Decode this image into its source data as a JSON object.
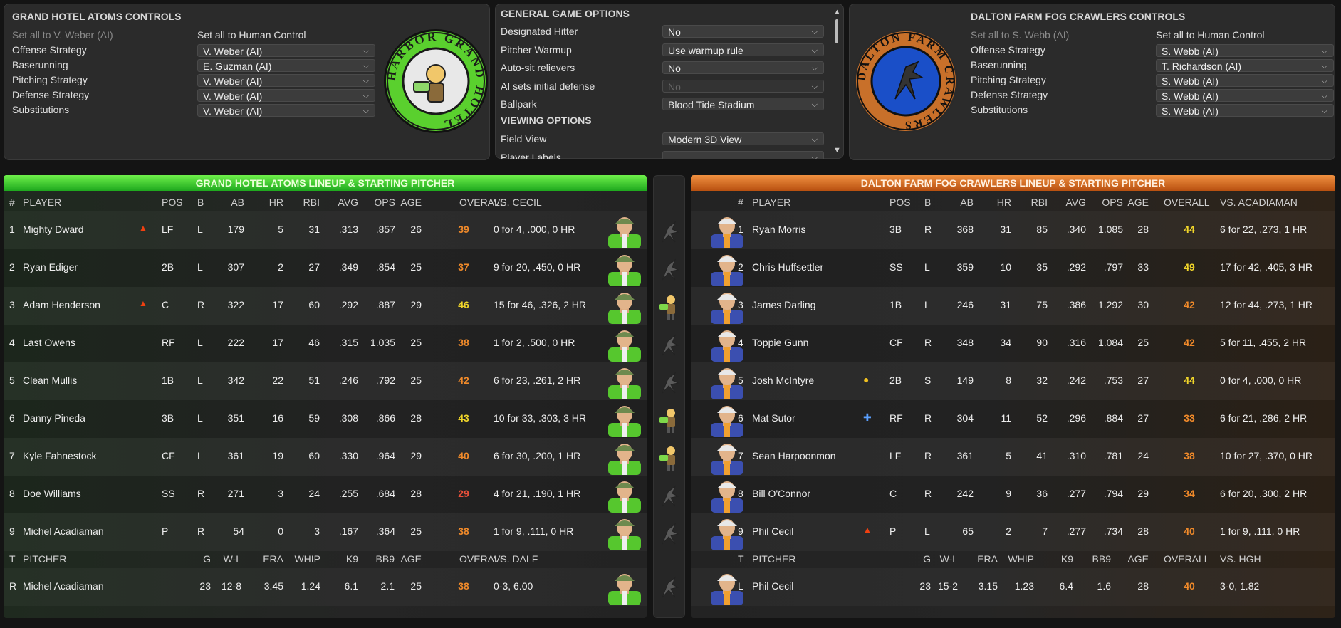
{
  "home_controls": {
    "title": "GRAND HOTEL ATOMS CONTROLS",
    "set_ai": "Set all to V. Weber (AI)",
    "set_human": "Set all to Human Control",
    "rows": [
      {
        "label": "Offense Strategy",
        "value": "V. Weber (AI)"
      },
      {
        "label": "Baserunning",
        "value": "E. Guzman (AI)"
      },
      {
        "label": "Pitching Strategy",
        "value": "V. Weber (AI)"
      },
      {
        "label": "Defense Strategy",
        "value": "V. Weber (AI)"
      },
      {
        "label": "Substitutions",
        "value": "V. Weber (AI)"
      }
    ],
    "logo_text": "HARBOR GRAND HOTEL"
  },
  "options": {
    "title": "GENERAL GAME OPTIONS",
    "rows": [
      {
        "label": "Designated Hitter",
        "value": "No"
      },
      {
        "label": "Pitcher Warmup",
        "value": "Use warmup rule"
      },
      {
        "label": "Auto-sit relievers",
        "value": "No"
      },
      {
        "label": "AI sets initial defense",
        "value": "No"
      },
      {
        "label": "Ballpark",
        "value": "Blood Tide Stadium"
      }
    ],
    "viewing_title": "VIEWING OPTIONS",
    "view_rows": [
      {
        "label": "Field View",
        "value": "Modern 3D View"
      },
      {
        "label": "Player Labels",
        "value": ""
      }
    ]
  },
  "away_controls": {
    "title": "DALTON FARM FOG CRAWLERS CONTROLS",
    "set_ai": "Set all to S. Webb (AI)",
    "set_human": "Set all to Human Control",
    "rows": [
      {
        "label": "Offense Strategy",
        "value": "S. Webb (AI)"
      },
      {
        "label": "Baserunning",
        "value": "T. Richardson (AI)"
      },
      {
        "label": "Pitching Strategy",
        "value": "S. Webb (AI)"
      },
      {
        "label": "Defense Strategy",
        "value": "S. Webb (AI)"
      },
      {
        "label": "Substitutions",
        "value": "S. Webb (AI)"
      }
    ],
    "logo_text": "DALTON FARM CRAWLERS"
  },
  "colors": {
    "green": "#2aa82a",
    "orange": "#d0651a",
    "ovr_orange": "#f08a2a",
    "ovr_yellow": "#f0d52a",
    "ovr_red": "#e8503a"
  },
  "left": {
    "bar_title": "GRAND HOTEL ATOMS LINEUP & STARTING PITCHER",
    "headers": {
      "num": "#",
      "player": "PLAYER",
      "pos": "POS",
      "b": "B",
      "ab": "AB",
      "hr": "HR",
      "rbi": "RBI",
      "avg": "AVG",
      "ops": "OPS",
      "age": "AGE",
      "ovr": "OVERALL",
      "vs": "VS. CECIL"
    },
    "players": [
      {
        "n": "1",
        "name": "Mighty Dward",
        "icon": "fire",
        "pos": "LF",
        "b": "L",
        "ab": "179",
        "hr": "5",
        "rbi": "31",
        "avg": ".313",
        "ops": ".857",
        "age": "26",
        "ovr": "39",
        "ovr_color": "orange",
        "vs": "0 for 4, .000, 0 HR",
        "opp": "crawler"
      },
      {
        "n": "2",
        "name": "Ryan Ediger",
        "icon": "",
        "pos": "2B",
        "b": "L",
        "ab": "307",
        "hr": "2",
        "rbi": "27",
        "avg": ".349",
        "ops": ".854",
        "age": "25",
        "ovr": "37",
        "ovr_color": "orange",
        "vs": "9 for 20, .450, 0 HR",
        "opp": "crawler"
      },
      {
        "n": "3",
        "name": "Adam Henderson",
        "icon": "fire",
        "pos": "C",
        "b": "R",
        "ab": "322",
        "hr": "17",
        "rbi": "60",
        "avg": ".292",
        "ops": ".887",
        "age": "29",
        "ovr": "46",
        "ovr_color": "yellow",
        "vs": "15 for 46, .326, 2 HR",
        "opp": "atom"
      },
      {
        "n": "4",
        "name": "Last Owens",
        "icon": "",
        "pos": "RF",
        "b": "L",
        "ab": "222",
        "hr": "17",
        "rbi": "46",
        "avg": ".315",
        "ops": "1.035",
        "age": "25",
        "ovr": "38",
        "ovr_color": "orange",
        "vs": "1 for 2, .500, 0 HR",
        "opp": "crawler"
      },
      {
        "n": "5",
        "name": "Clean Mullis",
        "icon": "",
        "pos": "1B",
        "b": "L",
        "ab": "342",
        "hr": "22",
        "rbi": "51",
        "avg": ".246",
        "ops": ".792",
        "age": "25",
        "ovr": "42",
        "ovr_color": "orange",
        "vs": "6 for 23, .261, 2 HR",
        "opp": "crawler"
      },
      {
        "n": "6",
        "name": "Danny Pineda",
        "icon": "",
        "pos": "3B",
        "b": "L",
        "ab": "351",
        "hr": "16",
        "rbi": "59",
        "avg": ".308",
        "ops": ".866",
        "age": "28",
        "ovr": "43",
        "ovr_color": "yellow",
        "vs": "10 for 33, .303, 3 HR",
        "opp": "atom"
      },
      {
        "n": "7",
        "name": "Kyle Fahnestock",
        "icon": "",
        "pos": "CF",
        "b": "L",
        "ab": "361",
        "hr": "19",
        "rbi": "60",
        "avg": ".330",
        "ops": ".964",
        "age": "29",
        "ovr": "40",
        "ovr_color": "orange",
        "vs": "6 for 30, .200, 1 HR",
        "opp": "atom"
      },
      {
        "n": "8",
        "name": "Doe Williams",
        "icon": "",
        "pos": "SS",
        "b": "R",
        "ab": "271",
        "hr": "3",
        "rbi": "24",
        "avg": ".255",
        "ops": ".684",
        "age": "28",
        "ovr": "29",
        "ovr_color": "red",
        "vs": "4 for 21, .190, 1 HR",
        "opp": "crawler"
      },
      {
        "n": "9",
        "name": "Michel Acadiaman",
        "icon": "",
        "pos": "P",
        "b": "R",
        "ab": "54",
        "hr": "0",
        "rbi": "3",
        "avg": ".167",
        "ops": ".364",
        "age": "25",
        "ovr": "38",
        "ovr_color": "orange",
        "vs": "1 for 9, .111, 0 HR",
        "opp": "crawler"
      }
    ],
    "pitcher_headers": {
      "t": "T",
      "pitcher": "PITCHER",
      "g": "G",
      "wl": "W-L",
      "era": "ERA",
      "whip": "WHIP",
      "k9": "K9",
      "bb9": "BB9",
      "age": "AGE",
      "ovr": "OVERALL",
      "vs": "VS. DALF"
    },
    "pitcher": {
      "t": "R",
      "name": "Michel Acadiaman",
      "g": "23",
      "wl": "12-8",
      "era": "3.45",
      "whip": "1.24",
      "k9": "6.1",
      "bb9": "2.1",
      "age": "25",
      "ovr": "38",
      "ovr_color": "orange",
      "vs": "0-3, 6.00",
      "opp": "crawler"
    }
  },
  "right": {
    "bar_title": "DALTON FARM FOG CRAWLERS LINEUP & STARTING PITCHER",
    "headers": {
      "num": "#",
      "player": "PLAYER",
      "pos": "POS",
      "b": "B",
      "ab": "AB",
      "hr": "HR",
      "rbi": "RBI",
      "avg": "AVG",
      "ops": "OPS",
      "age": "AGE",
      "ovr": "OVERALL",
      "vs": "VS. ACADIAMAN"
    },
    "players": [
      {
        "n": "1",
        "name": "Ryan Morris",
        "icon": "",
        "pos": "3B",
        "b": "R",
        "ab": "368",
        "hr": "31",
        "rbi": "85",
        "avg": ".340",
        "ops": "1.085",
        "age": "28",
        "ovr": "44",
        "ovr_color": "yellow",
        "vs": "6 for 22, .273, 1 HR"
      },
      {
        "n": "2",
        "name": "Chris Huffsettler",
        "icon": "",
        "pos": "SS",
        "b": "L",
        "ab": "359",
        "hr": "10",
        "rbi": "35",
        "avg": ".292",
        "ops": ".797",
        "age": "33",
        "ovr": "49",
        "ovr_color": "yellow",
        "vs": "17 for 42, .405, 3 HR"
      },
      {
        "n": "3",
        "name": "James Darling",
        "icon": "",
        "pos": "1B",
        "b": "L",
        "ab": "246",
        "hr": "31",
        "rbi": "75",
        "avg": ".386",
        "ops": "1.292",
        "age": "30",
        "ovr": "42",
        "ovr_color": "orange",
        "vs": "12 for 44, .273, 1 HR"
      },
      {
        "n": "4",
        "name": "Toppie Gunn",
        "icon": "",
        "pos": "CF",
        "b": "R",
        "ab": "348",
        "hr": "34",
        "rbi": "90",
        "avg": ".316",
        "ops": "1.084",
        "age": "25",
        "ovr": "42",
        "ovr_color": "orange",
        "vs": "5 for 11, .455, 2 HR"
      },
      {
        "n": "5",
        "name": "Josh McIntyre",
        "icon": "star",
        "pos": "2B",
        "b": "S",
        "ab": "149",
        "hr": "8",
        "rbi": "32",
        "avg": ".242",
        "ops": ".753",
        "age": "27",
        "ovr": "44",
        "ovr_color": "yellow",
        "vs": "0 for 4, .000, 0 HR"
      },
      {
        "n": "6",
        "name": "Mat Sutor",
        "icon": "cross",
        "pos": "RF",
        "b": "R",
        "ab": "304",
        "hr": "11",
        "rbi": "52",
        "avg": ".296",
        "ops": ".884",
        "age": "27",
        "ovr": "33",
        "ovr_color": "orange",
        "vs": "6 for 21, .286, 2 HR"
      },
      {
        "n": "7",
        "name": "Sean Harpoonmon",
        "icon": "",
        "pos": "LF",
        "b": "R",
        "ab": "361",
        "hr": "5",
        "rbi": "41",
        "avg": ".310",
        "ops": ".781",
        "age": "24",
        "ovr": "38",
        "ovr_color": "orange",
        "vs": "10 for 27, .370, 0 HR"
      },
      {
        "n": "8",
        "name": "Bill O'Connor",
        "icon": "",
        "pos": "C",
        "b": "R",
        "ab": "242",
        "hr": "9",
        "rbi": "36",
        "avg": ".277",
        "ops": ".794",
        "age": "29",
        "ovr": "34",
        "ovr_color": "orange",
        "vs": "6 for 20, .300, 2 HR"
      },
      {
        "n": "9",
        "name": "Phil Cecil",
        "icon": "fire",
        "pos": "P",
        "b": "L",
        "ab": "65",
        "hr": "2",
        "rbi": "7",
        "avg": ".277",
        "ops": ".734",
        "age": "28",
        "ovr": "40",
        "ovr_color": "orange",
        "vs": "1 for 9, .111, 0 HR"
      }
    ],
    "pitcher_headers": {
      "t": "T",
      "pitcher": "PITCHER",
      "g": "G",
      "wl": "W-L",
      "era": "ERA",
      "whip": "WHIP",
      "k9": "K9",
      "bb9": "BB9",
      "age": "AGE",
      "ovr": "OVERALL",
      "vs": "VS. HGH"
    },
    "pitcher": {
      "t": "L",
      "name": "Phil Cecil",
      "g": "23",
      "wl": "15-2",
      "era": "3.15",
      "whip": "1.23",
      "k9": "6.4",
      "bb9": "1.6",
      "age": "28",
      "ovr": "40",
      "ovr_color": "orange",
      "vs": "3-0, 1.82"
    }
  }
}
